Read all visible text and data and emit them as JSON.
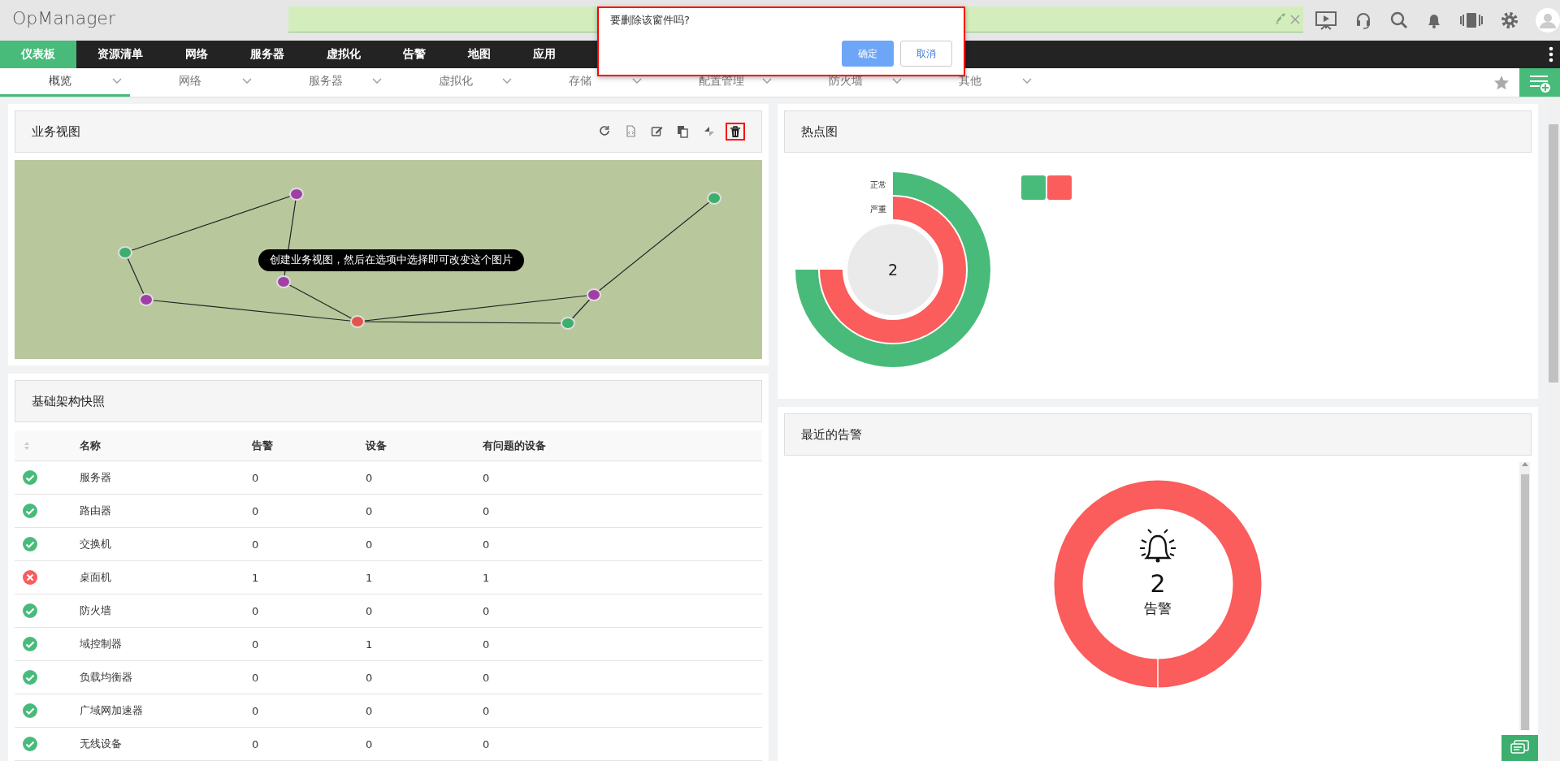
{
  "app": {
    "logo": "OpManager"
  },
  "main_nav": [
    {
      "label": "仪表板",
      "selected": true
    },
    {
      "label": "资源清单",
      "selected": false
    },
    {
      "label": "网络",
      "selected": false
    },
    {
      "label": "服务器",
      "selected": false
    },
    {
      "label": "虚拟化",
      "selected": false
    },
    {
      "label": "告警",
      "selected": false
    },
    {
      "label": "地图",
      "selected": false
    },
    {
      "label": "应用",
      "selected": false
    }
  ],
  "sub_nav": [
    {
      "label": "概览",
      "selected": true
    },
    {
      "label": "网络",
      "selected": false
    },
    {
      "label": "服务器",
      "selected": false
    },
    {
      "label": "虚拟化",
      "selected": false
    },
    {
      "label": "存储",
      "selected": false
    },
    {
      "label": "配置管理",
      "selected": false
    },
    {
      "label": "防火墙",
      "selected": false
    },
    {
      "label": "其他",
      "selected": false
    }
  ],
  "dialog": {
    "message": "要删除该窗件吗?",
    "buttons": [
      {
        "label": "确定",
        "kind": "primary"
      },
      {
        "label": "取消",
        "kind": "secondary"
      }
    ]
  },
  "business_view": {
    "title": "业务视图",
    "tools": [
      {
        "kind": "refresh",
        "highlighted": false
      },
      {
        "kind": "embed",
        "highlighted": false
      },
      {
        "kind": "edit",
        "highlighted": false
      },
      {
        "kind": "copy",
        "highlighted": false
      },
      {
        "kind": "resize",
        "highlighted": false
      },
      {
        "kind": "delete",
        "highlighted": true
      }
    ],
    "tooltip": "创建业务视图，然后在选项中选择即可改变这个图片",
    "nodes": [
      {
        "color": "#a23fa6"
      },
      {
        "color": "#3cae6e"
      },
      {
        "color": "#a23fa6"
      },
      {
        "color": "#a23fa6"
      },
      {
        "color": "#e2534c"
      },
      {
        "color": "#a23fa6"
      },
      {
        "color": "#3cae6e"
      },
      {
        "color": "#3cae6e"
      }
    ]
  },
  "infrastructure": {
    "title": "基础架构快照",
    "columns": [
      "名称",
      "告警",
      "设备",
      "有问题的设备"
    ],
    "rows": [
      {
        "kind": "ok",
        "name": "服务器",
        "alarms": "0",
        "devices": "0",
        "problem_devices": "0"
      },
      {
        "kind": "ok",
        "name": "路由器",
        "alarms": "0",
        "devices": "0",
        "problem_devices": "0"
      },
      {
        "kind": "ok",
        "name": "交换机",
        "alarms": "0",
        "devices": "0",
        "problem_devices": "0"
      },
      {
        "kind": "critical",
        "name": "桌面机",
        "alarms": "1",
        "devices": "1",
        "problem_devices": "1"
      },
      {
        "kind": "ok",
        "name": "防火墙",
        "alarms": "0",
        "devices": "0",
        "problem_devices": "0"
      },
      {
        "kind": "ok",
        "name": "域控制器",
        "alarms": "0",
        "devices": "1",
        "problem_devices": "0"
      },
      {
        "kind": "ok",
        "name": "负载均衡器",
        "alarms": "0",
        "devices": "0",
        "problem_devices": "0"
      },
      {
        "kind": "ok",
        "name": "广域网加速器",
        "alarms": "0",
        "devices": "0",
        "problem_devices": "0"
      },
      {
        "kind": "ok",
        "name": "无线设备",
        "alarms": "0",
        "devices": "0",
        "problem_devices": "0"
      }
    ]
  },
  "heatmap": {
    "title": "热点图",
    "center_value": "2",
    "rings": [
      {
        "label": "正常",
        "color": "#48bb7b"
      },
      {
        "label": "严重",
        "color": "#fb5c5c"
      }
    ],
    "legend": [
      {
        "color": "#48bb7b"
      },
      {
        "color": "#fb5c5c"
      }
    ]
  },
  "recent_alarms": {
    "title": "最近的告警",
    "count": "2",
    "label": "告警"
  }
}
